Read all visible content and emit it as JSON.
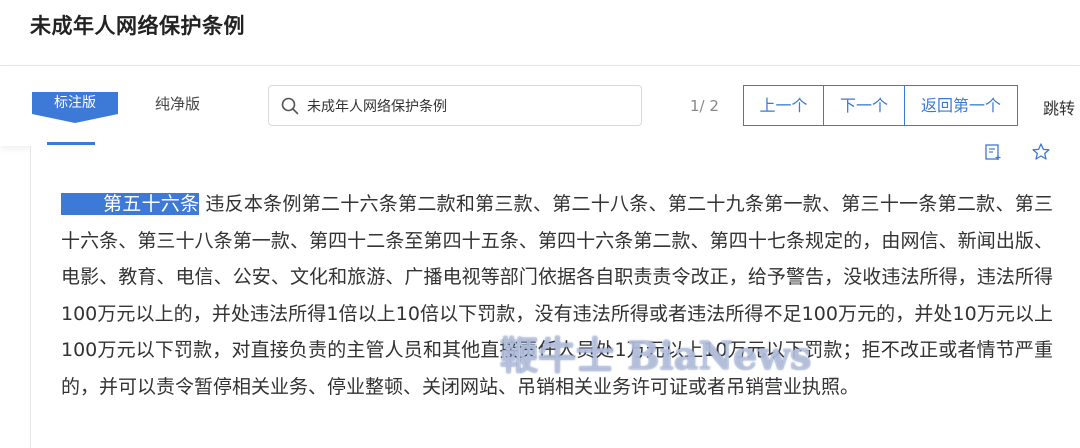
{
  "header": {
    "title": "未成年人网络保护条例"
  },
  "toolbar": {
    "tabs": [
      {
        "label": "标注版",
        "active": true
      },
      {
        "label": "纯净版",
        "active": false
      }
    ],
    "search": {
      "value": "未成年人网络保护条例",
      "placeholder": ""
    },
    "page_counter": "1/ 2",
    "prev_label": "上一个",
    "next_label": "下一个",
    "first_label": "返回第一个",
    "jump_label": "跳转"
  },
  "article": {
    "number": "第五十六条",
    "text": "违反本条例第二十六条第二款和第三款、第二十八条、第二十九条第一款、第三十一条第二款、第三十六条、第三十八条第一款、第四十二条至第四十五条、第四十六条第二款、第四十七条规定的，由网信、新闻出版、电影、教育、电信、公安、文化和旅游、广播电视等部门依据各自职责责令改正，给予警告，没收违法所得，违法所得100万元以上的，并处违法所得1倍以上10倍以下罚款，没有违法所得或者违法所得不足100万元的，并处10万元以上100万元以下罚款，对直接负责的主管人员和其他直接责任人员处1万元以上10万元以下罚款；拒不改正或者情节严重的，并可以责令暂停相关业务、停业整顿、关闭网站、吊销相关业务许可证或者吊销营业执照。"
  },
  "watermark": "鞭牛士 BiaNews",
  "colors": {
    "accent": "#3d79d6"
  },
  "icons": {
    "search": "search-icon",
    "note": "note-icon",
    "star": "star-icon"
  }
}
